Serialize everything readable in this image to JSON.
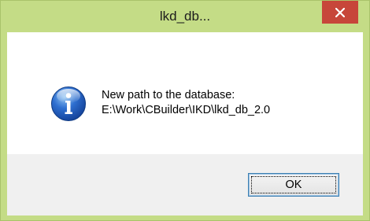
{
  "window": {
    "title": "lkd_db...",
    "frame_color": "#c4dc86",
    "close_button_color": "#c7463a",
    "close_icon": "close-icon"
  },
  "message": {
    "icon": "info-icon",
    "line1": "New path to the database:",
    "line2": "E:\\Work\\CBuilder\\IKD\\lkd_db_2.0"
  },
  "buttons": {
    "ok_label": "OK"
  }
}
